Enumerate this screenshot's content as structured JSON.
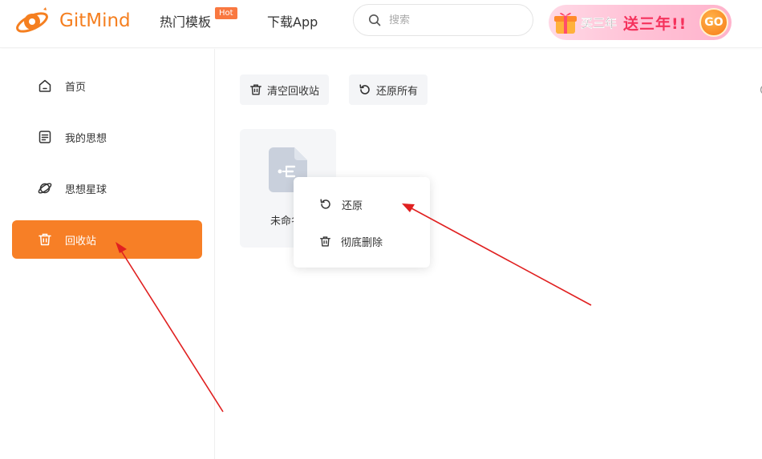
{
  "header": {
    "brand": "GitMind",
    "nav": [
      {
        "label": "热门模板",
        "badge": "Hot"
      },
      {
        "label": "下载App"
      }
    ],
    "search_placeholder": "搜索",
    "promo": {
      "text_black": "买三年",
      "text_red": "送三年!!",
      "cta": "GO"
    }
  },
  "sidebar": {
    "items": [
      {
        "label": "首页",
        "icon": "home-icon",
        "active": false
      },
      {
        "label": "我的思想",
        "icon": "document-icon",
        "active": false
      },
      {
        "label": "思想星球",
        "icon": "planet-icon",
        "active": false
      },
      {
        "label": "回收站",
        "icon": "trash-icon",
        "active": true
      }
    ]
  },
  "toolbar": {
    "empty_label": "清空回收站",
    "restore_all_label": "还原所有"
  },
  "files": [
    {
      "name": "未命名",
      "icon": "mindmap-file-icon"
    }
  ],
  "context_menu": {
    "items": [
      {
        "label": "还原",
        "icon": "restore-icon"
      },
      {
        "label": "彻底删除",
        "icon": "trash-icon"
      }
    ]
  },
  "colors": {
    "accent": "#f77f26",
    "hot_badge": "#f97840",
    "annotation_arrow": "#e02020"
  }
}
